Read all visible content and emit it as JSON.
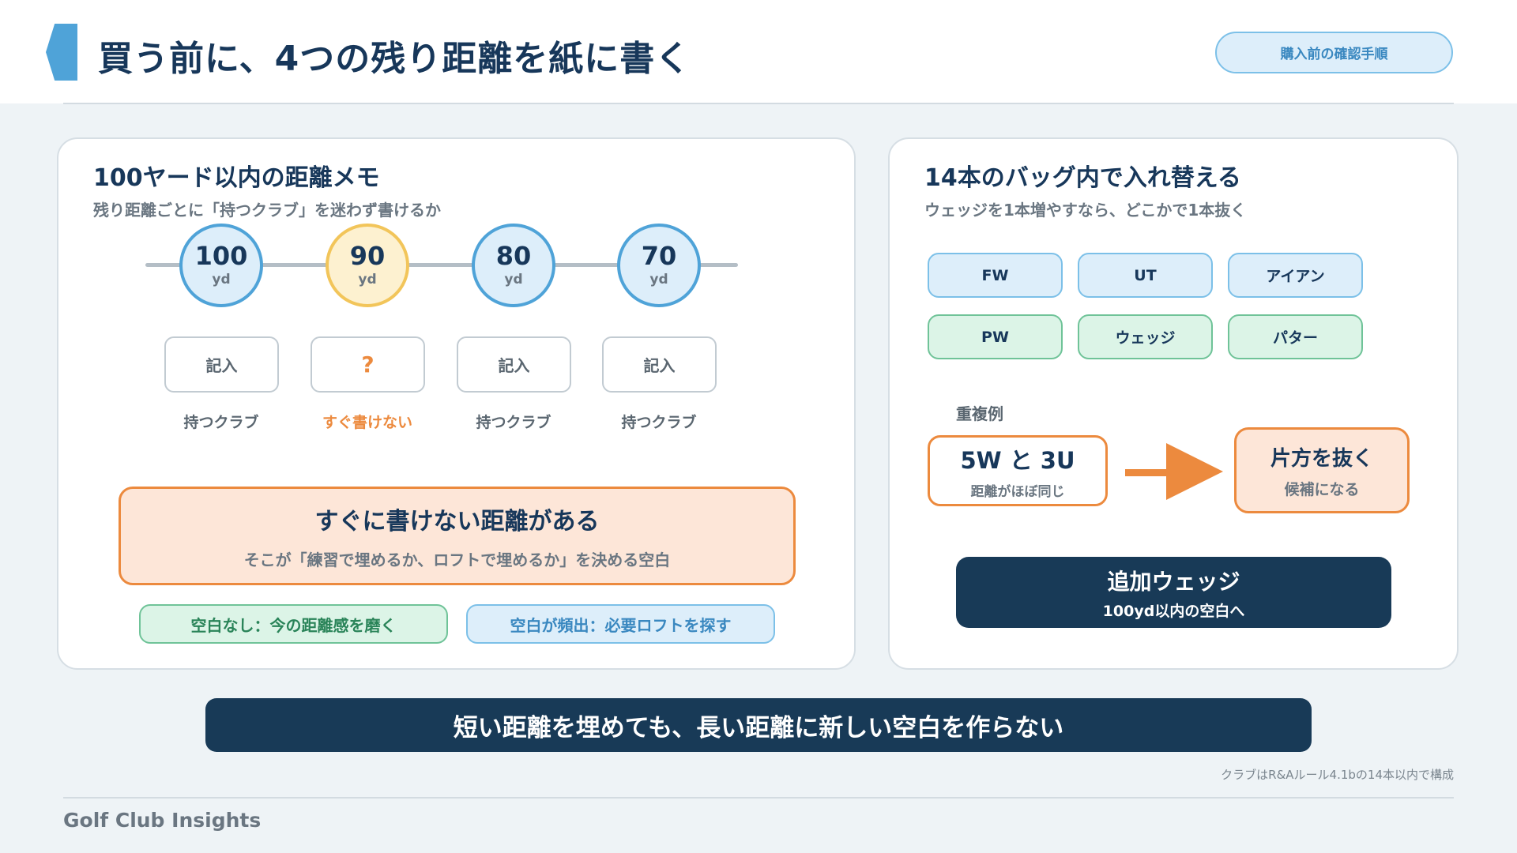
{
  "header": {
    "title": "買う前に、4つの残り距離を紙に書く",
    "badge": "購入前の確認手順"
  },
  "distance_memo": {
    "title": "100ヤード以内の距離メモ",
    "subtitle": "残り距離ごとに「持つクラブ」を迷わず書けるか",
    "items": [
      {
        "distance": "100",
        "unit": "yd",
        "box": "記入",
        "caption": "持つクラブ",
        "state": "ok"
      },
      {
        "distance": "90",
        "unit": "yd",
        "box": "?",
        "caption": "すぐ書けない",
        "state": "warn"
      },
      {
        "distance": "80",
        "unit": "yd",
        "box": "記入",
        "caption": "持つクラブ",
        "state": "ok"
      },
      {
        "distance": "70",
        "unit": "yd",
        "box": "記入",
        "caption": "持つクラブ",
        "state": "ok"
      }
    ],
    "callout": {
      "title": "すぐに書けない距離がある",
      "body": "そこが「練習で埋めるか、ロフトで埋めるか」を決める空白"
    },
    "pill_green": "空白なし：今の距離感を磨く",
    "pill_blue": "空白が頻出：必要ロフトを探す"
  },
  "bag": {
    "title": "14本のバッグ内で入れ替える",
    "subtitle": "ウェッジを1本増やすなら、どこかで1本抜く",
    "clubs_row1": [
      "FW",
      "UT",
      "アイアン"
    ],
    "clubs_row2": [
      "PW",
      "ウェッジ",
      "パター"
    ],
    "example_label": "重複例",
    "duplicate": {
      "title": "5W と 3U",
      "sub": "距離がほぼ同じ"
    },
    "result": {
      "title": "片方を抜く",
      "sub": "候補になる"
    },
    "addition": {
      "title": "追加ウェッジ",
      "sub": "100yd以内の空白へ"
    }
  },
  "banner": "短い距離を埋めても、長い距離に新しい空白を作らない",
  "footnote": "クラブはR&Aルール4.1bの14本以内で構成",
  "brand": "Golf Club Insights",
  "colors": {
    "navy": "#183a57",
    "accent_blue": "#4fa3d8",
    "accent_orange": "#ec8a3e",
    "accent_yellow": "#f2c55a",
    "accent_green": "#6fc398"
  }
}
